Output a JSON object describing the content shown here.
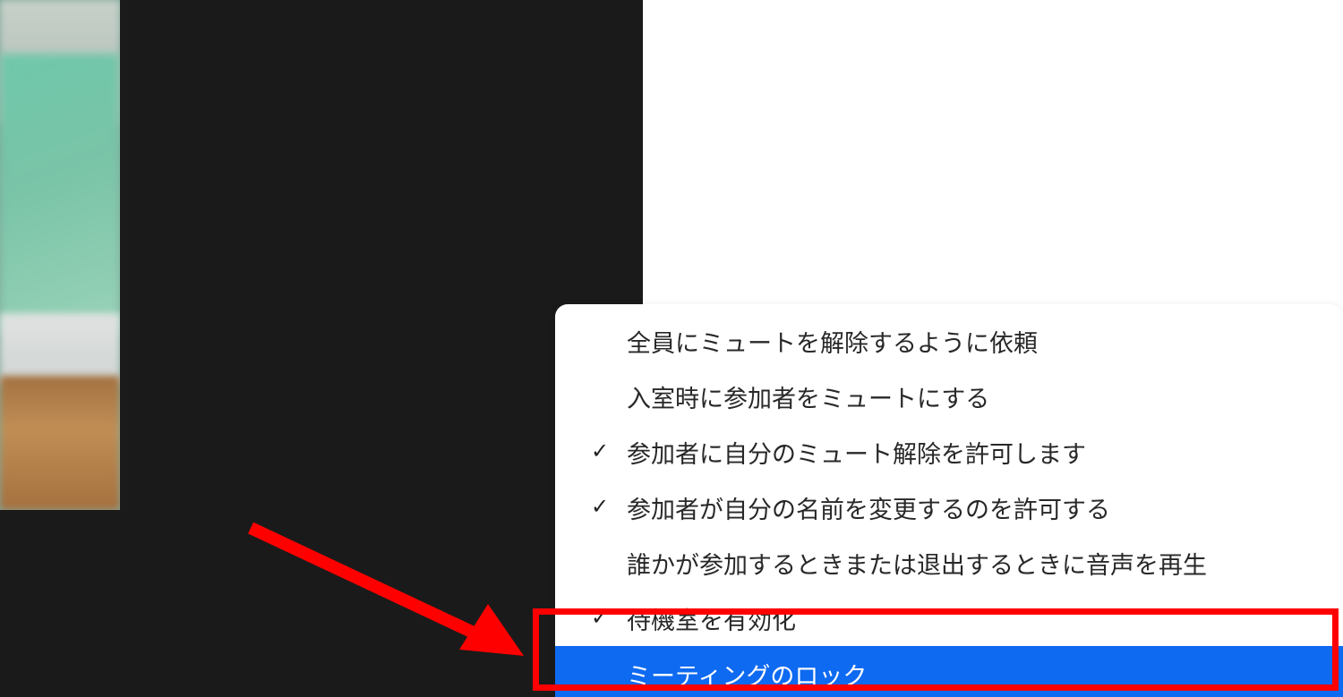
{
  "thumbnail": {
    "semantic": "video-thumb"
  },
  "menu": {
    "items": [
      {
        "label": "全員にミュートを解除するように依頼",
        "checked": false,
        "highlighted": false
      },
      {
        "label": "入室時に参加者をミュートにする",
        "checked": false,
        "highlighted": false
      },
      {
        "label": "参加者に自分のミュート解除を許可します",
        "checked": true,
        "highlighted": false
      },
      {
        "label": "参加者が自分の名前を変更するのを許可する",
        "checked": true,
        "highlighted": false
      },
      {
        "label": "誰かが参加するときまたは退出するときに音声を再生",
        "checked": false,
        "highlighted": false
      },
      {
        "label": "待機室を有効化",
        "checked": true,
        "highlighted": false
      },
      {
        "label": "ミーティングのロック",
        "checked": false,
        "highlighted": true
      }
    ]
  },
  "annotation": {
    "highlight_box_color": "#ff0000",
    "arrow_color": "#ff0000"
  }
}
